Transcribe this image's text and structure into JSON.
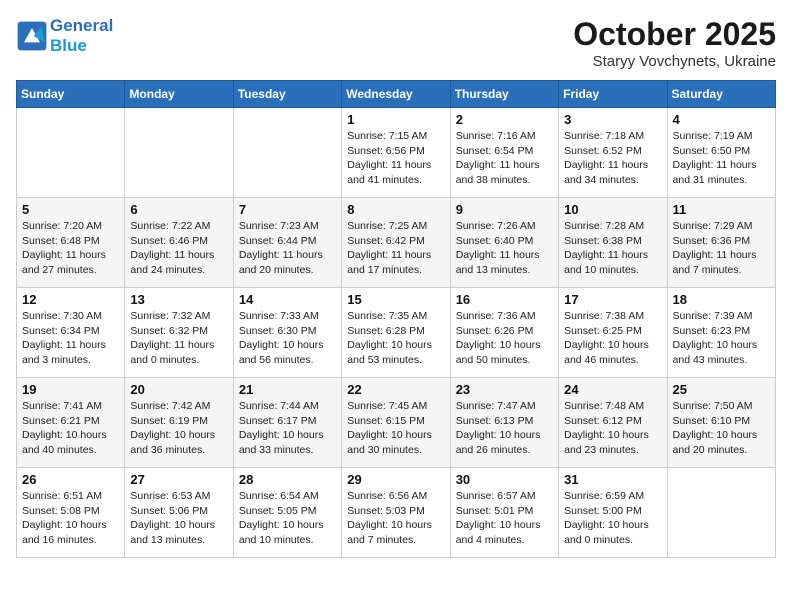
{
  "header": {
    "logo_line1": "General",
    "logo_line2": "Blue",
    "month_title": "October 2025",
    "location": "Staryy Vovchynets, Ukraine"
  },
  "weekdays": [
    "Sunday",
    "Monday",
    "Tuesday",
    "Wednesday",
    "Thursday",
    "Friday",
    "Saturday"
  ],
  "weeks": [
    [
      {
        "day": "",
        "info": ""
      },
      {
        "day": "",
        "info": ""
      },
      {
        "day": "",
        "info": ""
      },
      {
        "day": "1",
        "info": "Sunrise: 7:15 AM\nSunset: 6:56 PM\nDaylight: 11 hours and 41 minutes."
      },
      {
        "day": "2",
        "info": "Sunrise: 7:16 AM\nSunset: 6:54 PM\nDaylight: 11 hours and 38 minutes."
      },
      {
        "day": "3",
        "info": "Sunrise: 7:18 AM\nSunset: 6:52 PM\nDaylight: 11 hours and 34 minutes."
      },
      {
        "day": "4",
        "info": "Sunrise: 7:19 AM\nSunset: 6:50 PM\nDaylight: 11 hours and 31 minutes."
      }
    ],
    [
      {
        "day": "5",
        "info": "Sunrise: 7:20 AM\nSunset: 6:48 PM\nDaylight: 11 hours and 27 minutes."
      },
      {
        "day": "6",
        "info": "Sunrise: 7:22 AM\nSunset: 6:46 PM\nDaylight: 11 hours and 24 minutes."
      },
      {
        "day": "7",
        "info": "Sunrise: 7:23 AM\nSunset: 6:44 PM\nDaylight: 11 hours and 20 minutes."
      },
      {
        "day": "8",
        "info": "Sunrise: 7:25 AM\nSunset: 6:42 PM\nDaylight: 11 hours and 17 minutes."
      },
      {
        "day": "9",
        "info": "Sunrise: 7:26 AM\nSunset: 6:40 PM\nDaylight: 11 hours and 13 minutes."
      },
      {
        "day": "10",
        "info": "Sunrise: 7:28 AM\nSunset: 6:38 PM\nDaylight: 11 hours and 10 minutes."
      },
      {
        "day": "11",
        "info": "Sunrise: 7:29 AM\nSunset: 6:36 PM\nDaylight: 11 hours and 7 minutes."
      }
    ],
    [
      {
        "day": "12",
        "info": "Sunrise: 7:30 AM\nSunset: 6:34 PM\nDaylight: 11 hours and 3 minutes."
      },
      {
        "day": "13",
        "info": "Sunrise: 7:32 AM\nSunset: 6:32 PM\nDaylight: 11 hours and 0 minutes."
      },
      {
        "day": "14",
        "info": "Sunrise: 7:33 AM\nSunset: 6:30 PM\nDaylight: 10 hours and 56 minutes."
      },
      {
        "day": "15",
        "info": "Sunrise: 7:35 AM\nSunset: 6:28 PM\nDaylight: 10 hours and 53 minutes."
      },
      {
        "day": "16",
        "info": "Sunrise: 7:36 AM\nSunset: 6:26 PM\nDaylight: 10 hours and 50 minutes."
      },
      {
        "day": "17",
        "info": "Sunrise: 7:38 AM\nSunset: 6:25 PM\nDaylight: 10 hours and 46 minutes."
      },
      {
        "day": "18",
        "info": "Sunrise: 7:39 AM\nSunset: 6:23 PM\nDaylight: 10 hours and 43 minutes."
      }
    ],
    [
      {
        "day": "19",
        "info": "Sunrise: 7:41 AM\nSunset: 6:21 PM\nDaylight: 10 hours and 40 minutes."
      },
      {
        "day": "20",
        "info": "Sunrise: 7:42 AM\nSunset: 6:19 PM\nDaylight: 10 hours and 36 minutes."
      },
      {
        "day": "21",
        "info": "Sunrise: 7:44 AM\nSunset: 6:17 PM\nDaylight: 10 hours and 33 minutes."
      },
      {
        "day": "22",
        "info": "Sunrise: 7:45 AM\nSunset: 6:15 PM\nDaylight: 10 hours and 30 minutes."
      },
      {
        "day": "23",
        "info": "Sunrise: 7:47 AM\nSunset: 6:13 PM\nDaylight: 10 hours and 26 minutes."
      },
      {
        "day": "24",
        "info": "Sunrise: 7:48 AM\nSunset: 6:12 PM\nDaylight: 10 hours and 23 minutes."
      },
      {
        "day": "25",
        "info": "Sunrise: 7:50 AM\nSunset: 6:10 PM\nDaylight: 10 hours and 20 minutes."
      }
    ],
    [
      {
        "day": "26",
        "info": "Sunrise: 6:51 AM\nSunset: 5:08 PM\nDaylight: 10 hours and 16 minutes."
      },
      {
        "day": "27",
        "info": "Sunrise: 6:53 AM\nSunset: 5:06 PM\nDaylight: 10 hours and 13 minutes."
      },
      {
        "day": "28",
        "info": "Sunrise: 6:54 AM\nSunset: 5:05 PM\nDaylight: 10 hours and 10 minutes."
      },
      {
        "day": "29",
        "info": "Sunrise: 6:56 AM\nSunset: 5:03 PM\nDaylight: 10 hours and 7 minutes."
      },
      {
        "day": "30",
        "info": "Sunrise: 6:57 AM\nSunset: 5:01 PM\nDaylight: 10 hours and 4 minutes."
      },
      {
        "day": "31",
        "info": "Sunrise: 6:59 AM\nSunset: 5:00 PM\nDaylight: 10 hours and 0 minutes."
      },
      {
        "day": "",
        "info": ""
      }
    ]
  ]
}
